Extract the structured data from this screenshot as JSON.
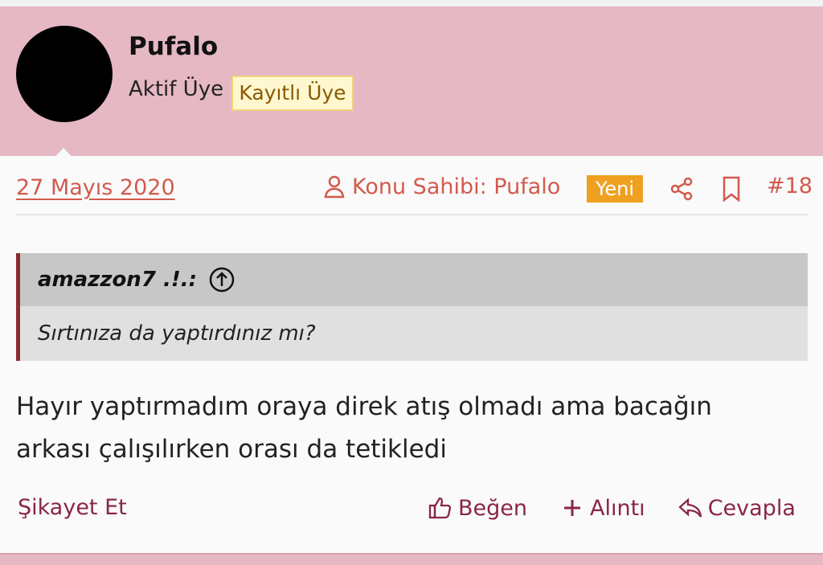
{
  "post": {
    "author": "Pufalo",
    "role": "Aktif Üye",
    "badge": "Kayıtlı Üye",
    "date": "27 Mayıs 2020",
    "owner_label": "Konu Sahibi: Pufalo",
    "new_label": "Yeni",
    "number": "#18"
  },
  "quote": {
    "author": "amazzon7 .!.:",
    "text": "Sırtınıza da yaptırdınız mı?"
  },
  "message": {
    "line1": "Hayır yaptırmadım oraya direk atış olmadı ama bacağın",
    "line2": "arkası çalışılırken orası da tetikledi"
  },
  "footer": {
    "report": "Şikayet Et",
    "like": "Beğen",
    "quote": "Alıntı",
    "reply": "Cevapla"
  },
  "colors": {
    "header_bg": "#e5b8c4",
    "link_red": "#d25a4d",
    "footer_text": "#8a2548",
    "new_badge": "#f0a020",
    "quote_border": "#8b2d2d"
  },
  "icons": [
    "user-icon",
    "share-icon",
    "bookmark-icon",
    "arrow-up-circle-icon",
    "thumbs-up-icon",
    "plus-icon",
    "reply-icon"
  ]
}
